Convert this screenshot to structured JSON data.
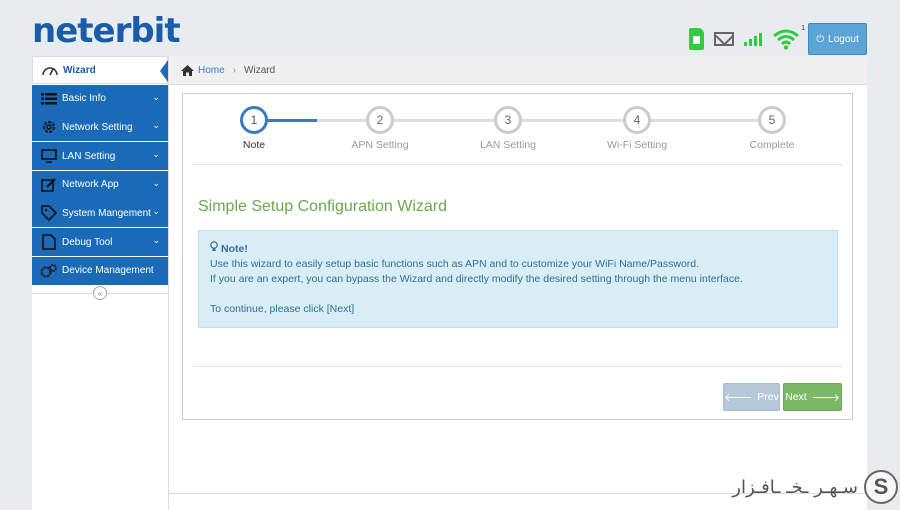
{
  "header": {
    "logo_text": "neterbit",
    "wifi_count": "1",
    "logout_label": "Logout",
    "colors": {
      "brand": "#1a5ca8",
      "status_green": "#2ecc40",
      "logout_bg": "#5aa4d6"
    }
  },
  "sidebar": {
    "items": [
      {
        "label": "Wizard",
        "icon": "dashboard-icon",
        "active": true
      },
      {
        "label": "Basic Info",
        "icon": "list-icon"
      },
      {
        "label": "Network Setting",
        "icon": "gear-icon"
      },
      {
        "label": "LAN Setting",
        "icon": "monitor-icon"
      },
      {
        "label": "Network App",
        "icon": "edit-icon"
      },
      {
        "label": "System Mangement",
        "icon": "tag-icon"
      },
      {
        "label": "Debug Tool",
        "icon": "document-icon"
      },
      {
        "label": "Device Management",
        "icon": "gears-icon"
      }
    ],
    "collapse_glyph": "«"
  },
  "breadcrumb": {
    "home": "Home",
    "current": "Wizard"
  },
  "wizard": {
    "steps": [
      {
        "number": "1",
        "label": "Note",
        "active": true
      },
      {
        "number": "2",
        "label": "APN Setting"
      },
      {
        "number": "3",
        "label": "LAN Setting"
      },
      {
        "number": "4",
        "label": "Wi-Fi Setting"
      },
      {
        "number": "5",
        "label": "Complete"
      }
    ],
    "title": "Simple Setup Configuration Wizard",
    "note": {
      "heading": "Note!",
      "line1": "Use this wizard to easily setup basic functions such as APN and to customize your WiFi Name/Password.",
      "line2": "If you are an expert, you can bypass the Wizard and directly modify the desired setting through the menu interface.",
      "line3": "To continue, please click [Next]"
    },
    "prev_label": "Prev",
    "next_label": "Next"
  },
  "watermark": {
    "text": "سـهـر ـخـ ـافـزار",
    "logo_letter": "S"
  }
}
